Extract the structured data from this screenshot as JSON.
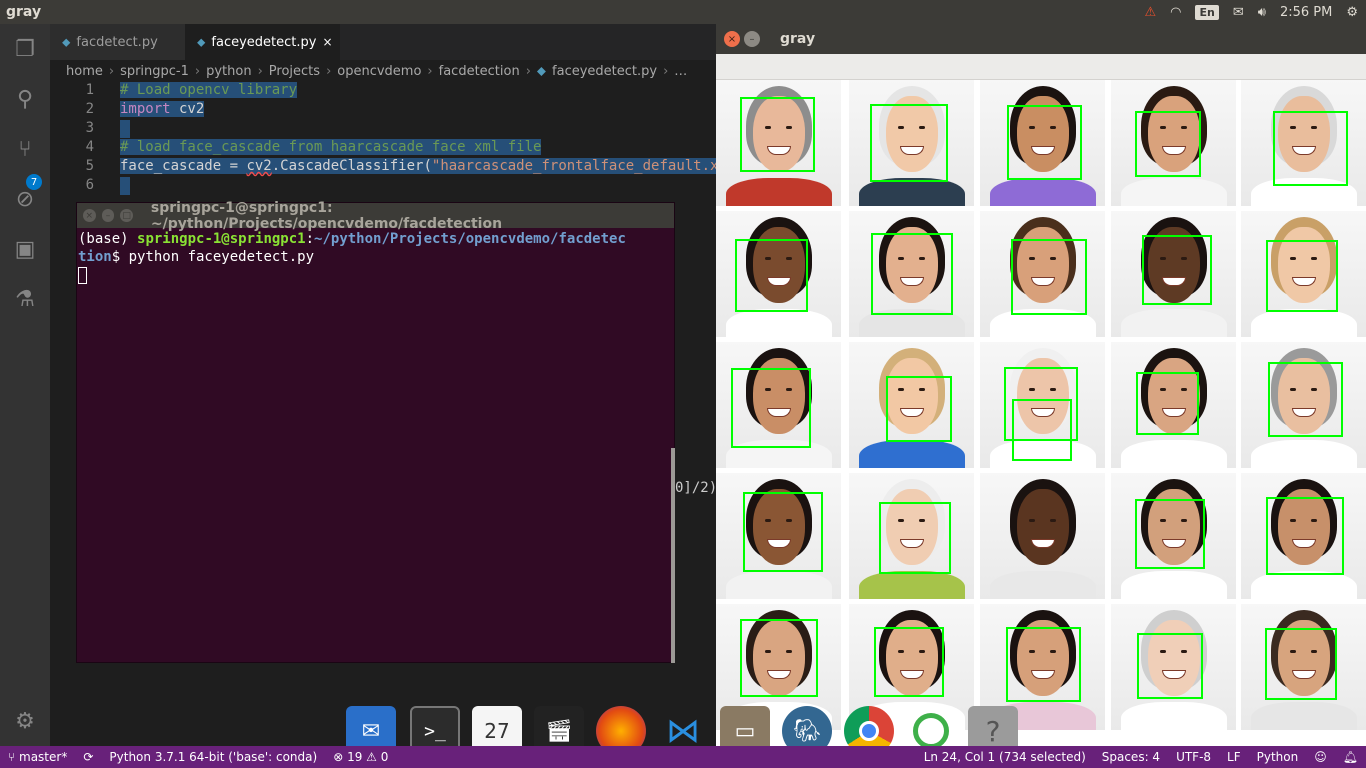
{
  "topbar": {
    "title": "gray",
    "keyboard": "En",
    "time": "2:56 PM",
    "icons": [
      "warning-icon",
      "wifi-icon",
      "mail-icon",
      "volume-icon",
      "gear-icon"
    ]
  },
  "vscode": {
    "scm_badge": "7",
    "tabs": [
      {
        "label": "facdetect.py",
        "active": false
      },
      {
        "label": "faceyedetect.py",
        "active": true,
        "close": "×"
      }
    ],
    "breadcrumbs": [
      "home",
      "springpc-1",
      "python",
      "Projects",
      "opencvdemo",
      "facdetection",
      "faceyedetect.py",
      "…"
    ],
    "lines": [
      {
        "no": "1",
        "text": "# Load opencv library"
      },
      {
        "no": "2",
        "text_kw": "import",
        "text_rest": " cv2"
      },
      {
        "no": "3",
        "text": ""
      },
      {
        "no": "4",
        "text": "# load face_cascade from haarcascade face xml file"
      },
      {
        "no": "5",
        "text_a": "face_cascade = ",
        "text_b": "cv2",
        "text_c": ".CascadeClassifier(",
        "text_str": "\"haarcascade_frontalface_default.x"
      },
      {
        "no": "6",
        "text": ""
      }
    ]
  },
  "terminal": {
    "title": "springpc-1@springpc1: ~/python/Projects/opencvdemo/facdetection",
    "prompt_prefix": "(base) ",
    "user_host": "springpc-1@springpc1",
    "colon": ":",
    "path_line1": "~/python/Projects/opencvdemo/facdetec",
    "path_line2": "tion",
    "dollar": "$ ",
    "command": "python faceyedetect.py"
  },
  "editor_overflow": "0]/2)",
  "gray_window": {
    "title": "gray"
  },
  "dock": {
    "items": [
      "thunderbird-icon",
      "terminal-icon",
      "calendar-icon",
      "video-editor-icon",
      "firefox-icon",
      "vscode-icon",
      "files-icon",
      "postgresql-icon",
      "chrome-icon",
      "anaconda-icon",
      "unknown-app-icon"
    ],
    "calendar_day": "27",
    "unknown_label": "?"
  },
  "statusbar": {
    "branch": "master*",
    "python": "Python 3.7.1 64-bit ('base': conda)",
    "errors": "19",
    "warnings": "0",
    "position": "Ln 24, Col 1 (734 selected)",
    "spaces": "Spaces: 4",
    "encoding": "UTF-8",
    "eol": "LF",
    "language": "Python"
  }
}
